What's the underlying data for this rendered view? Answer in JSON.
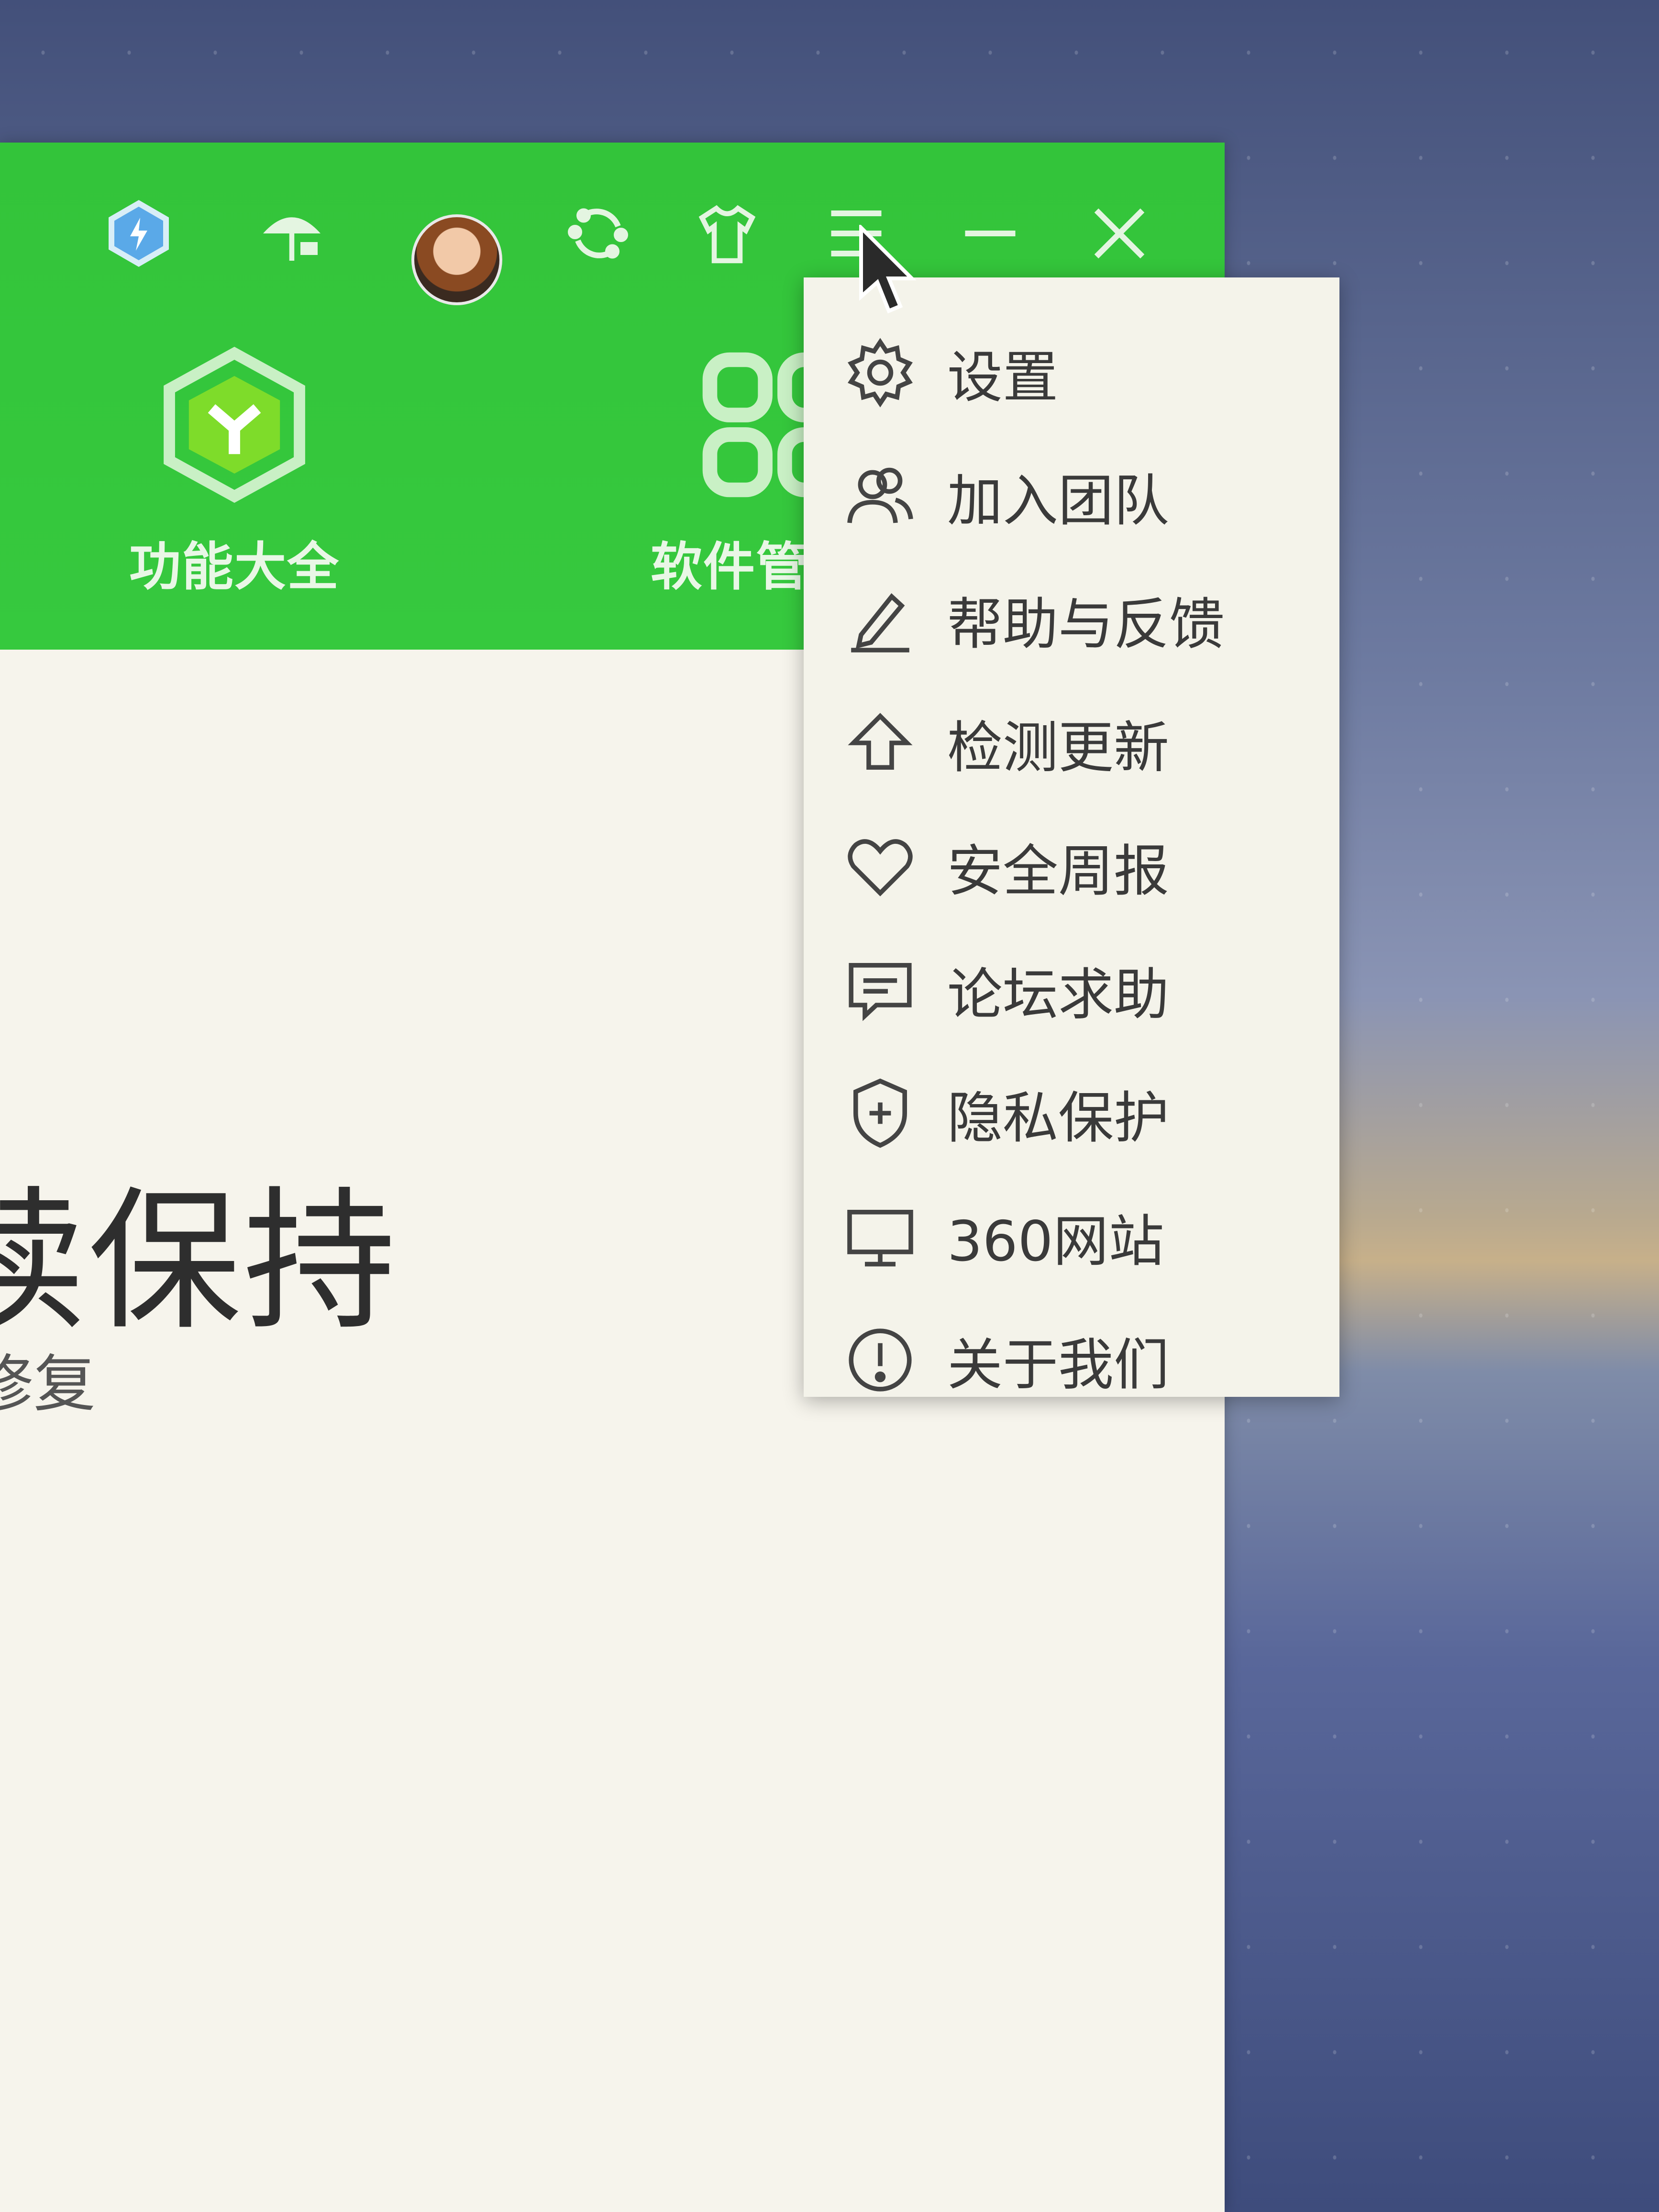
{
  "window": {
    "tabs": [
      {
        "label": "功能大全"
      },
      {
        "label": "软件管"
      }
    ],
    "content": {
      "headline": "续保持",
      "subline": "修复"
    }
  },
  "menu": {
    "items": [
      {
        "label": "设置",
        "icon": "gear-icon"
      },
      {
        "label": "加入团队",
        "icon": "team-icon"
      },
      {
        "label": "帮助与反馈",
        "icon": "pencil-icon"
      },
      {
        "label": "检测更新",
        "icon": "upload-arrow-icon"
      },
      {
        "label": "安全周报",
        "icon": "heart-icon"
      },
      {
        "label": "论坛求助",
        "icon": "message-icon"
      },
      {
        "label": "隐私保护",
        "icon": "shield-icon"
      },
      {
        "label": "360网站",
        "icon": "monitor-icon"
      },
      {
        "label": "关于我们",
        "icon": "info-icon"
      }
    ]
  },
  "colors": {
    "titlebar": "#36c93e",
    "menu_bg": "#f4f3ea",
    "text": "#3a3a3a"
  }
}
